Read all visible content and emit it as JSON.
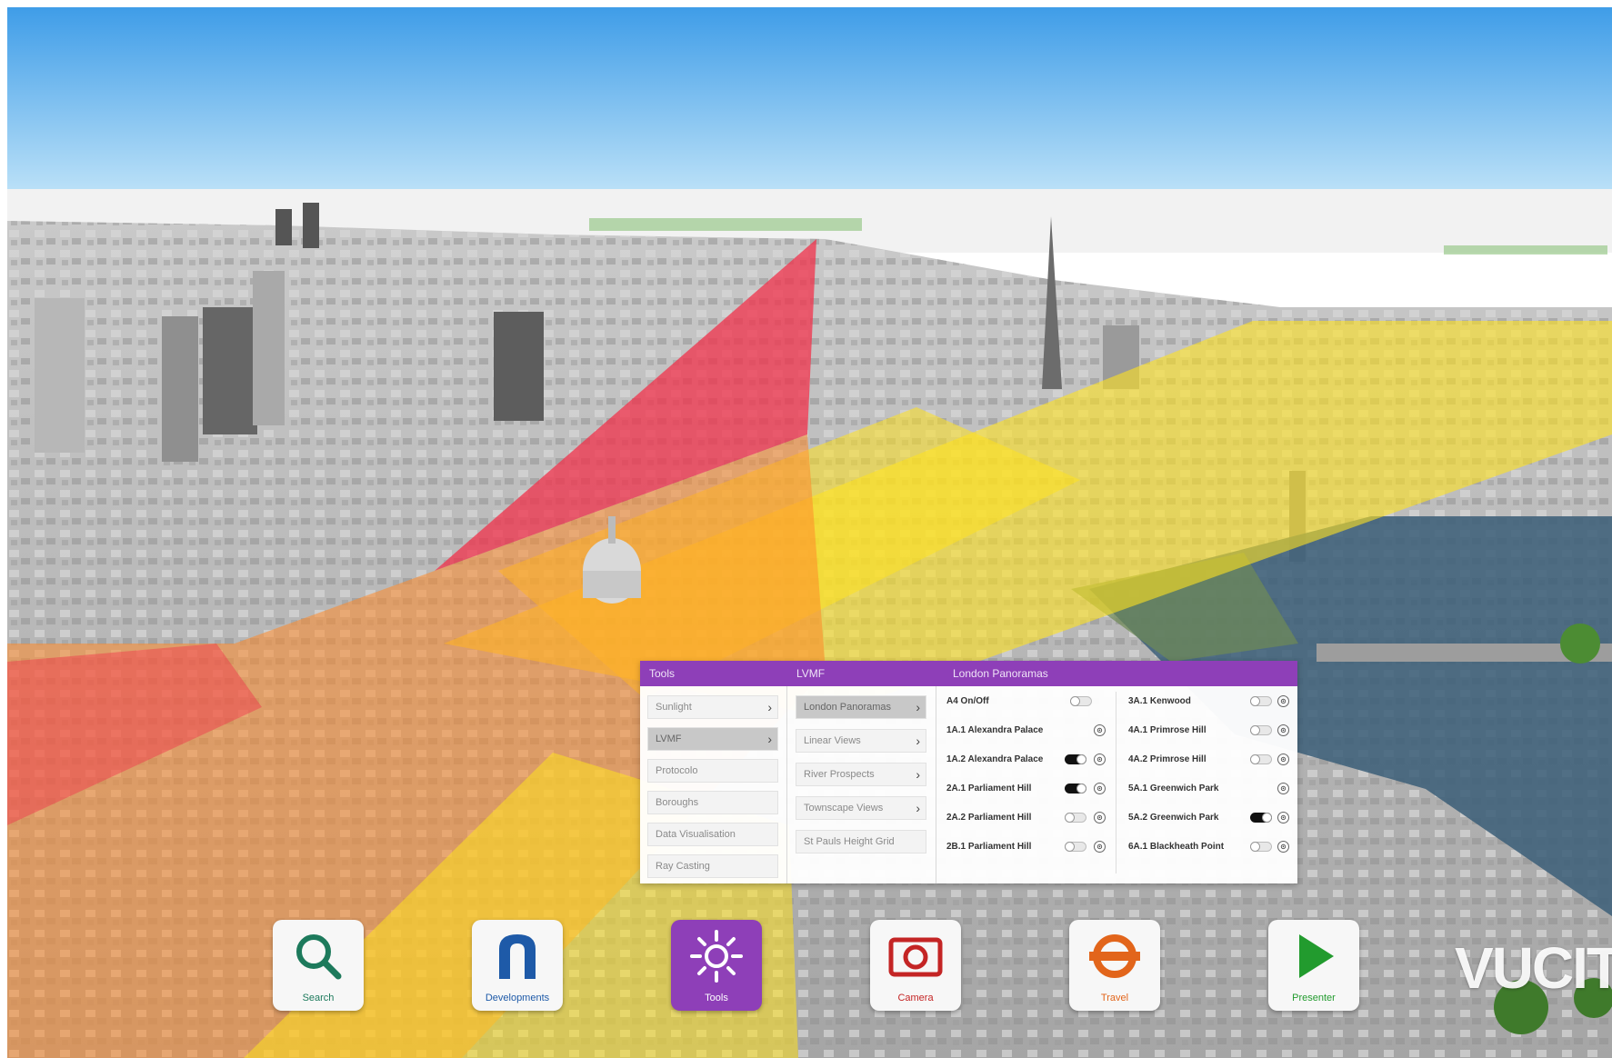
{
  "colors": {
    "accent_purple": "#8e3fb8",
    "viewcone_red": "#f2324b",
    "viewcone_orange": "#ff8a2a",
    "viewcone_yellow": "#ffe21f"
  },
  "panel": {
    "headers": {
      "tools": "Tools",
      "lvmf": "LVMF",
      "london_panoramas": "London Panoramas"
    },
    "tools_menu": [
      {
        "label": "Sunlight",
        "chevron": "›"
      },
      {
        "label": "LVMF",
        "chevron": "›"
      },
      {
        "label": "Protocolo",
        "chevron": ""
      },
      {
        "label": "Boroughs",
        "chevron": ""
      },
      {
        "label": "Data Visualisation",
        "chevron": ""
      },
      {
        "label": "Ray Casting",
        "chevron": ""
      }
    ],
    "lvmf_menu": [
      {
        "label": "London Panoramas",
        "chevron": "›"
      },
      {
        "label": "Linear Views",
        "chevron": "›"
      },
      {
        "label": "River Prospects",
        "chevron": "›"
      },
      {
        "label": "Townscape Views",
        "chevron": "›"
      },
      {
        "label": "St Pauls Height Grid",
        "chevron": ""
      }
    ],
    "views_left": [
      {
        "name": "A4 On/Off",
        "toggle": "off"
      },
      {
        "name": "1A.1 Alexandra Palace",
        "toggle": "none"
      },
      {
        "name": "1A.2 Alexandra Palace",
        "toggle": "on"
      },
      {
        "name": "2A.1 Parliament Hill",
        "toggle": "on"
      },
      {
        "name": "2A.2 Parliament Hill",
        "toggle": "off"
      },
      {
        "name": "2B.1 Parliament Hill",
        "toggle": "off"
      }
    ],
    "views_right": [
      {
        "name": "3A.1 Kenwood",
        "toggle": "off"
      },
      {
        "name": "4A.1 Primrose Hill",
        "toggle": "off"
      },
      {
        "name": "4A.2 Primrose Hill",
        "toggle": "off"
      },
      {
        "name": "5A.1 Greenwich Park",
        "toggle": "none"
      },
      {
        "name": "5A.2 Greenwich Park",
        "toggle": "on"
      },
      {
        "name": "6A.1 Blackheath Point",
        "toggle": "off"
      }
    ]
  },
  "toolbar": {
    "search": {
      "label": "Search",
      "icon": "magnifier-icon",
      "color": "#1d7a5c"
    },
    "developments": {
      "label": "Developments",
      "icon": "arch-icon",
      "color": "#1e5aa8"
    },
    "tools": {
      "label": "Tools",
      "icon": "sun-icon",
      "color": "#ffffff"
    },
    "camera": {
      "label": "Camera",
      "icon": "camera-icon",
      "color": "#c42525"
    },
    "travel": {
      "label": "Travel",
      "icon": "roundel-icon",
      "color": "#e2651b"
    },
    "presenter": {
      "label": "Presenter",
      "icon": "play-icon",
      "color": "#229b2e"
    }
  },
  "brand": "VUCIT"
}
